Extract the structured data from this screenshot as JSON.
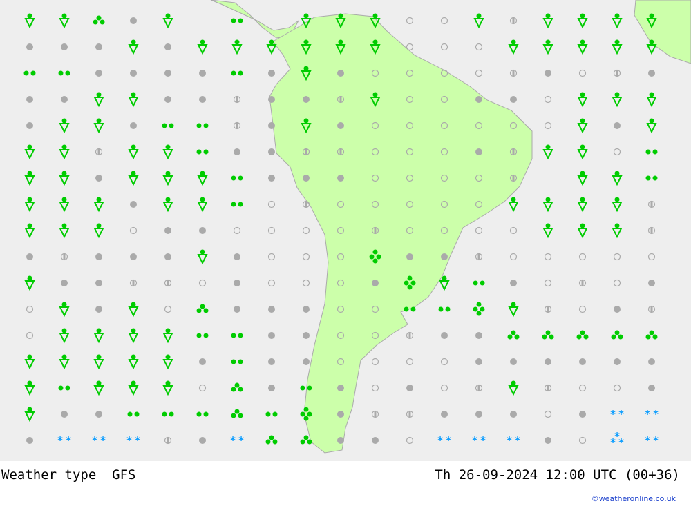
{
  "title": "Weather type",
  "model": "GFS",
  "valid_time": "Th 26-09-2024 12:00 UTC (00+36)",
  "credit": "©weatheronline.co.uk",
  "colors": {
    "sea": "#eeeeee",
    "land": "#ccffaa",
    "border": "#aaaaaa",
    "rain": "#00cc00",
    "cloud": "#aaaaaa",
    "snow": "#0099ff"
  },
  "legend_codes": {
    "S": "shower-icon",
    "R": "rain-icon",
    "H": "heavy-rain-icon",
    "V": "very-heavy-rain-icon",
    "O": "overcast-icon",
    "C": "clear-icon",
    "P": "partly-cloudy-icon",
    "N": "snow-icon",
    "T": "heavy-snow-icon",
    "_": "none"
  },
  "grid": [
    "SSHOS_R_SSSCCSPSSSS",
    "OOOSOSSSSSSCCCSSSSS",
    "RROOOOROSOCCCCPOCPO",
    "OOSSOOPOOPSCCOOCSSS",
    "OSSORRPOSOCCCCCCSOS",
    "SSPSSROOPPCCCOPSSCR",
    "SSOSSSROOOCCCCP_SSR",
    "SSSOSSRCPCCCCCSSSSP",
    "SSSCOOCCCCPCCCCSSSP",
    "OPOOOSOCCCVOOPCCCCC",
    "SOOPPCOCCCOVSROCPCO",
    "CSOSCHOOOCCRRVSPCOP",
    "CSSSSRROOCCPOOHHHHH",
    "SSSSSOROOCCCCOOOOOO",
    "SRSSSCHOROCOCPSPCCO",
    "SOORRRHRVOPPOOOCONN",
    "ONNNPONHHOOCNNNOCTN"
  ]
}
